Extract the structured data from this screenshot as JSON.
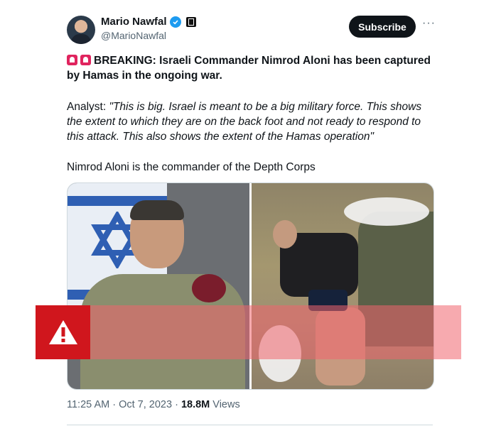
{
  "author": {
    "name": "Mario Nawfal",
    "handle": "@MarioNawfal",
    "verified": true
  },
  "actions": {
    "subscribe_label": "Subscribe",
    "more_label": "···"
  },
  "tweet": {
    "headline": "BREAKING: Israeli Commander Nimrod Aloni has been captured by Hamas in the ongoing war.",
    "analyst_label": "Analyst: ",
    "analyst_quote": "\"This is big. Israel is meant to be a big military force. This shows the extent to which they are on the back foot and not ready to respond to this attack. This also shows the extent of the Hamas operation\"",
    "footnote": "Nimrod Aloni is the commander of the Depth Corps"
  },
  "meta": {
    "time": "11:25 AM · Oct 7, 2023 · ",
    "views_count": "18.8M",
    "views_label": " Views"
  },
  "warning": {
    "icon": "warning-triangle-icon",
    "color": "#d0161d"
  },
  "colors": {
    "accent": "#1d9bf0",
    "button": "#0f1419",
    "muted": "#536471"
  }
}
